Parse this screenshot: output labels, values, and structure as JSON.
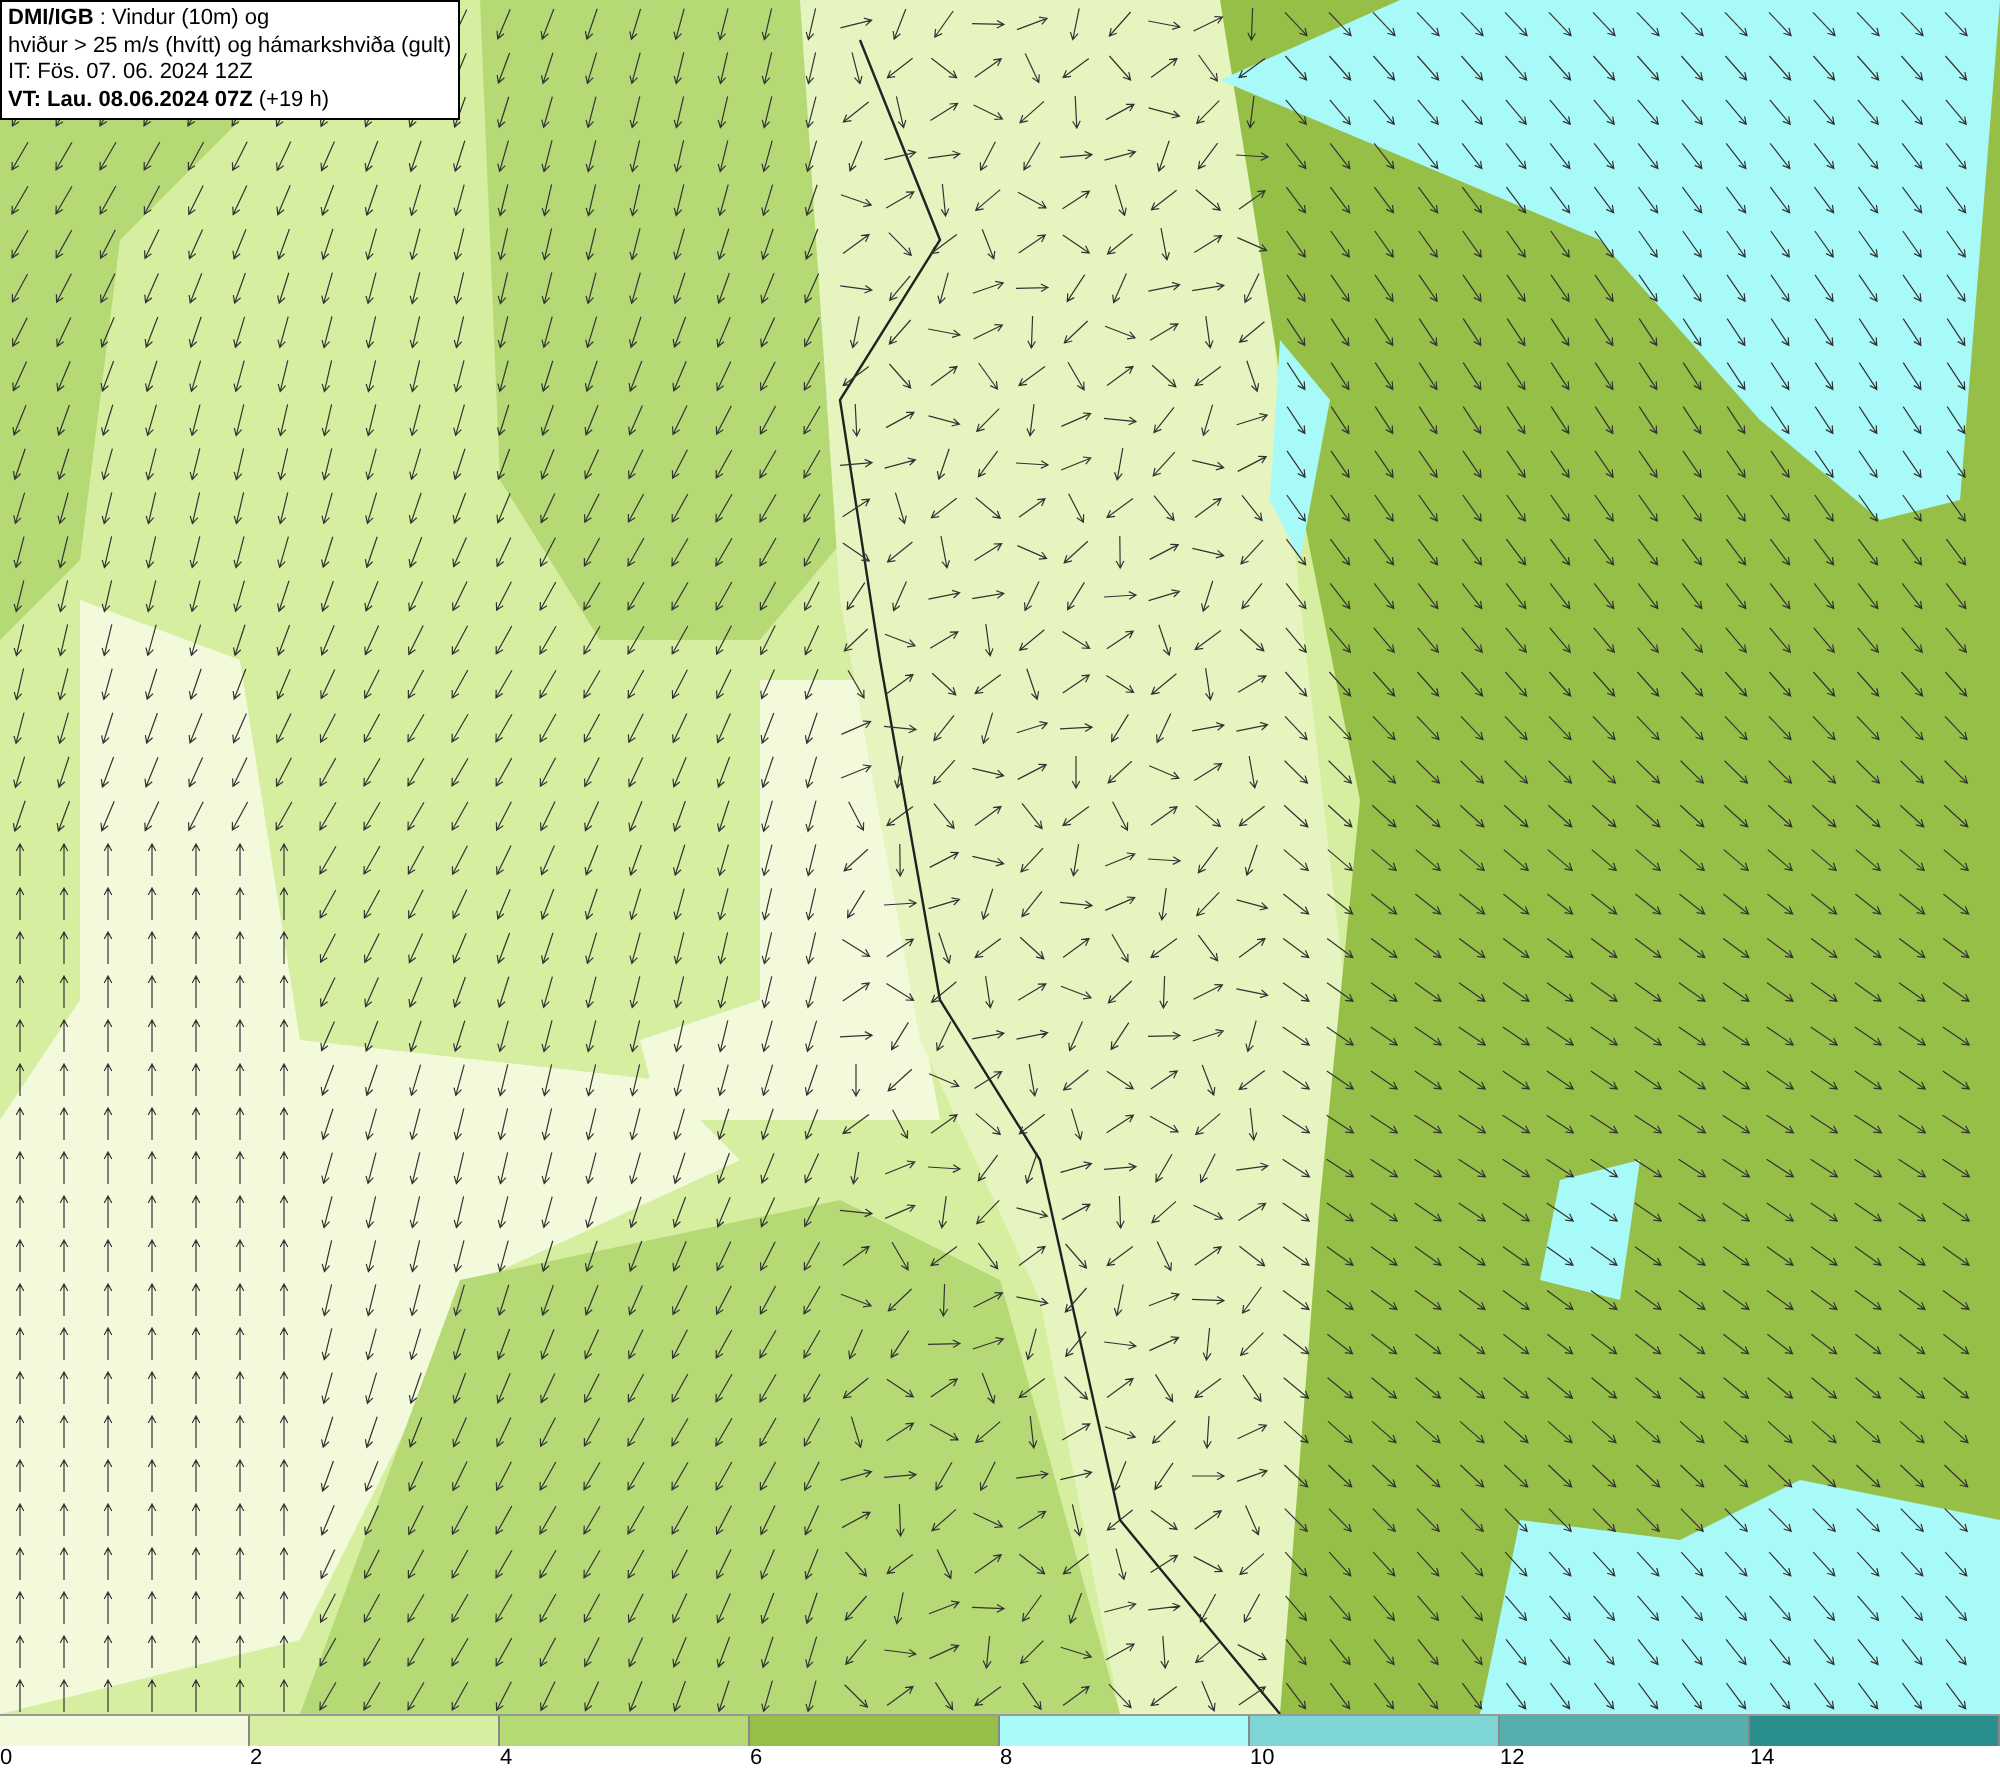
{
  "map": {
    "info_box": [
      "**DMI/IGB** : Vindur (10m) og",
      "hviður > 25 m/s (hvítt) og hámarkshviða (gult)",
      "IT: Fös. 07. 06. 2024 12Z",
      "**VT: Lau. 08.06.2024 07Z** (+19 h)"
    ]
  },
  "legend": {
    "bins": [
      {
        "label": "0",
        "color": "#f3fadc"
      },
      {
        "label": "2",
        "color": "#d6eea0"
      },
      {
        "label": "4",
        "color": "#b5d975"
      },
      {
        "label": "6",
        "color": "#96bf48"
      },
      {
        "label": "8",
        "color": "#a8faf8"
      },
      {
        "label": "10",
        "color": "#7dd6d4"
      },
      {
        "label": "12",
        "color": "#55b0ad"
      },
      {
        "label": "14",
        "color": "#2a8f8c"
      }
    ]
  }
}
